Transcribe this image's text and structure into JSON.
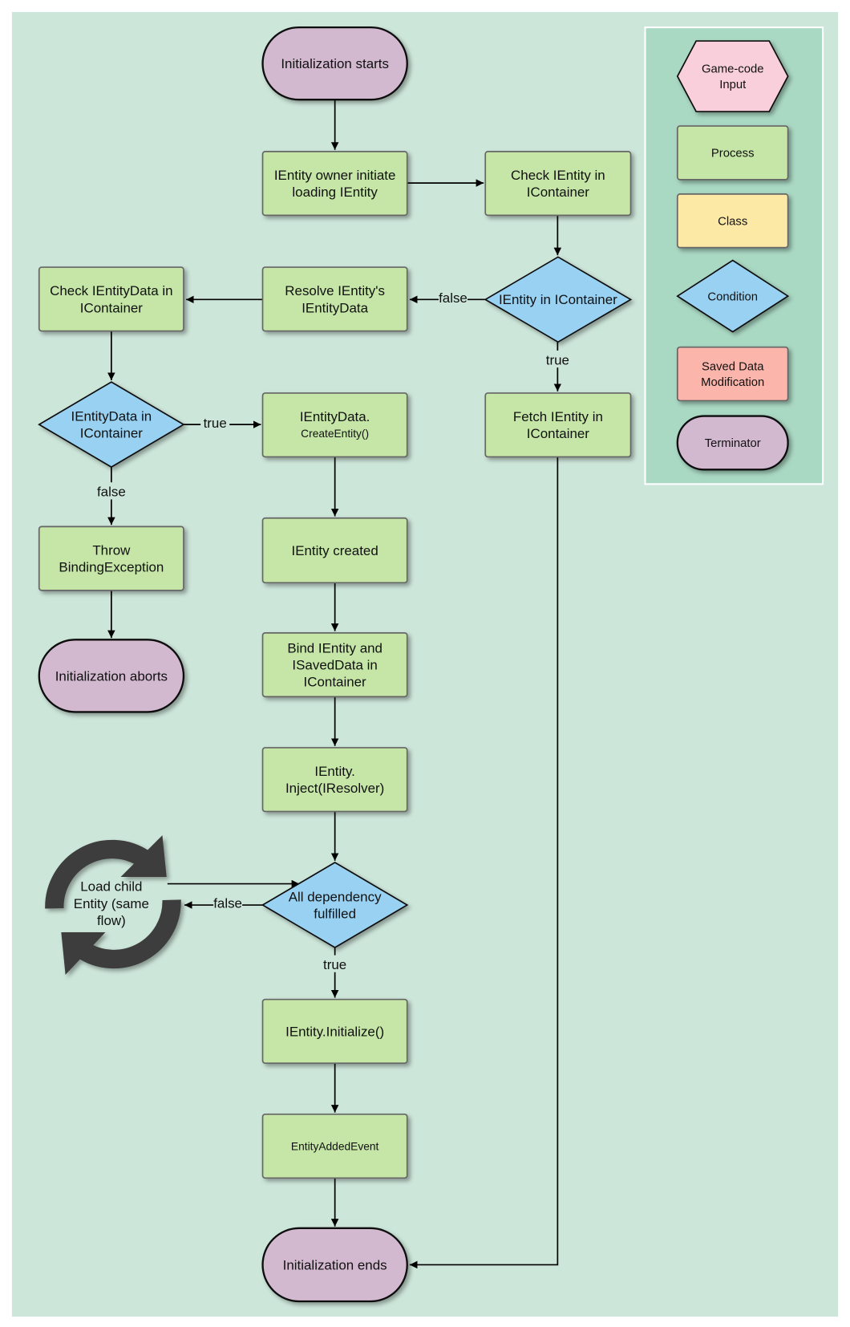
{
  "colors": {
    "background": "#cde6da",
    "legend_panel": "#a9d8c3",
    "process": "#c5e6a6",
    "condition": "#99d1f2",
    "terminator": "#d3b9d0",
    "game_code_input": "#f9cfdc",
    "class": "#fde9a6",
    "saved_data_modification": "#fbb5ab",
    "cycle_icon": "#3d3d3d"
  },
  "legend": [
    {
      "id": "legend-game-code-input",
      "shape": "hexagon",
      "lines": [
        "Game-code",
        "Input"
      ]
    },
    {
      "id": "legend-process",
      "shape": "process",
      "lines": [
        "Process"
      ]
    },
    {
      "id": "legend-class",
      "shape": "class",
      "lines": [
        "Class"
      ]
    },
    {
      "id": "legend-condition",
      "shape": "diamond",
      "lines": [
        "Condition"
      ]
    },
    {
      "id": "legend-saved-data-modification",
      "shape": "saved",
      "lines": [
        "Saved Data",
        "Modification"
      ]
    },
    {
      "id": "legend-terminator",
      "shape": "terminator",
      "lines": [
        "Terminator"
      ]
    }
  ],
  "nodes": [
    {
      "id": "init-starts",
      "shape": "terminator",
      "lines": [
        "Initialization starts"
      ]
    },
    {
      "id": "owner-initiate",
      "shape": "process",
      "lines": [
        "IEntity owner initiate",
        "loading IEntity"
      ]
    },
    {
      "id": "check-ientity",
      "shape": "process",
      "lines": [
        "Check IEntity in",
        "IContainer"
      ]
    },
    {
      "id": "ientity-in-icontainer",
      "shape": "diamond",
      "lines": [
        "IEntity in IContainer"
      ]
    },
    {
      "id": "resolve-entitydata",
      "shape": "process",
      "lines": [
        "Resolve IEntity's",
        "IEntityData"
      ]
    },
    {
      "id": "check-ientitydata",
      "shape": "process",
      "lines": [
        "Check IEntityData in",
        "IContainer"
      ]
    },
    {
      "id": "ientitydata-in-icontainer",
      "shape": "diamond",
      "lines": [
        "IEntityData in",
        "IContainer"
      ]
    },
    {
      "id": "create-entity",
      "shape": "process",
      "lines": [
        "IEntityData.",
        "CreateEntity()"
      ]
    },
    {
      "id": "fetch-ientity",
      "shape": "process",
      "lines": [
        "Fetch IEntity in",
        "IContainer"
      ]
    },
    {
      "id": "throw-binding",
      "shape": "process",
      "lines": [
        "Throw",
        "BindingException"
      ]
    },
    {
      "id": "init-aborts",
      "shape": "terminator",
      "lines": [
        "Initialization aborts"
      ]
    },
    {
      "id": "ientity-created",
      "shape": "process",
      "lines": [
        "IEntity created"
      ]
    },
    {
      "id": "bind-ientity",
      "shape": "process",
      "lines": [
        "Bind IEntity and",
        "ISavedData in",
        "IContainer"
      ]
    },
    {
      "id": "inject",
      "shape": "process",
      "lines": [
        "IEntity.",
        "Inject(IResolver)"
      ]
    },
    {
      "id": "all-dependency",
      "shape": "diamond",
      "lines": [
        "All dependency",
        "fulfilled"
      ]
    },
    {
      "id": "initialize",
      "shape": "process",
      "lines": [
        "IEntity.Initialize()"
      ]
    },
    {
      "id": "entity-added-event",
      "shape": "process",
      "lines": [
        "EntityAddedEvent"
      ]
    },
    {
      "id": "init-ends",
      "shape": "terminator",
      "lines": [
        "Initialization ends"
      ]
    }
  ],
  "cycle": {
    "icon": "refresh-cycle-icon",
    "lines": [
      "Load child",
      "Entity (same",
      "flow)"
    ]
  },
  "edge_labels": {
    "ientity_false": "false",
    "ientity_true": "true",
    "entitydata_true": "true",
    "entitydata_false": "false",
    "dependency_false": "false",
    "dependency_true": "true"
  }
}
